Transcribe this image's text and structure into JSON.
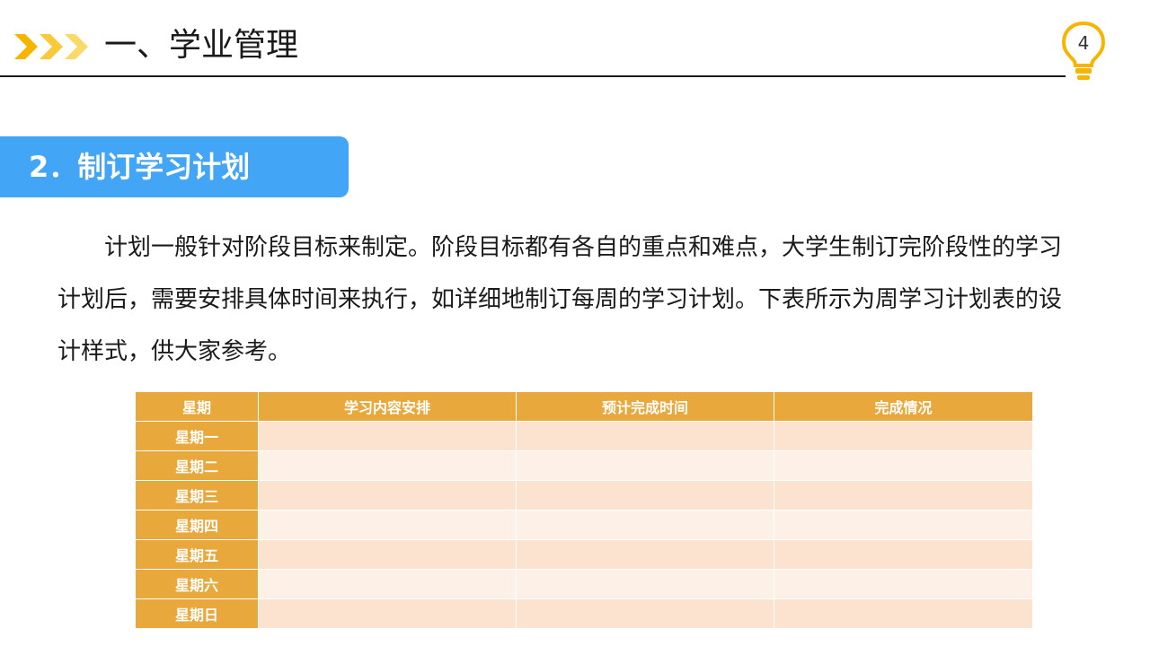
{
  "header": {
    "title": "一、学业管理",
    "page_number": "4",
    "accent_color": "#f7b500",
    "chevron_icon": "triple-chevron-right-icon",
    "bulb_icon": "lightbulb-icon"
  },
  "section": {
    "title": "2．制订学习计划",
    "bar_color": "#42a5f5"
  },
  "body": {
    "paragraph": "计划一般针对阶段目标来制定。阶段目标都有各自的重点和难点，大学生制订完阶段性的学习计划后，需要安排具体时间来执行，如详细地制订每周的学习计划。下表所示为周学习计划表的设计样式，供大家参考。"
  },
  "table": {
    "header_color": "#e9a83b",
    "columns": [
      "星期",
      "学习内容安排",
      "预计完成时间",
      "完成情况"
    ],
    "rows": [
      {
        "day": "星期一",
        "content": "",
        "time": "",
        "status": ""
      },
      {
        "day": "星期二",
        "content": "",
        "time": "",
        "status": ""
      },
      {
        "day": "星期三",
        "content": "",
        "time": "",
        "status": ""
      },
      {
        "day": "星期四",
        "content": "",
        "time": "",
        "status": ""
      },
      {
        "day": "星期五",
        "content": "",
        "time": "",
        "status": ""
      },
      {
        "day": "星期六",
        "content": "",
        "time": "",
        "status": ""
      },
      {
        "day": "星期日",
        "content": "",
        "time": "",
        "status": ""
      }
    ]
  }
}
